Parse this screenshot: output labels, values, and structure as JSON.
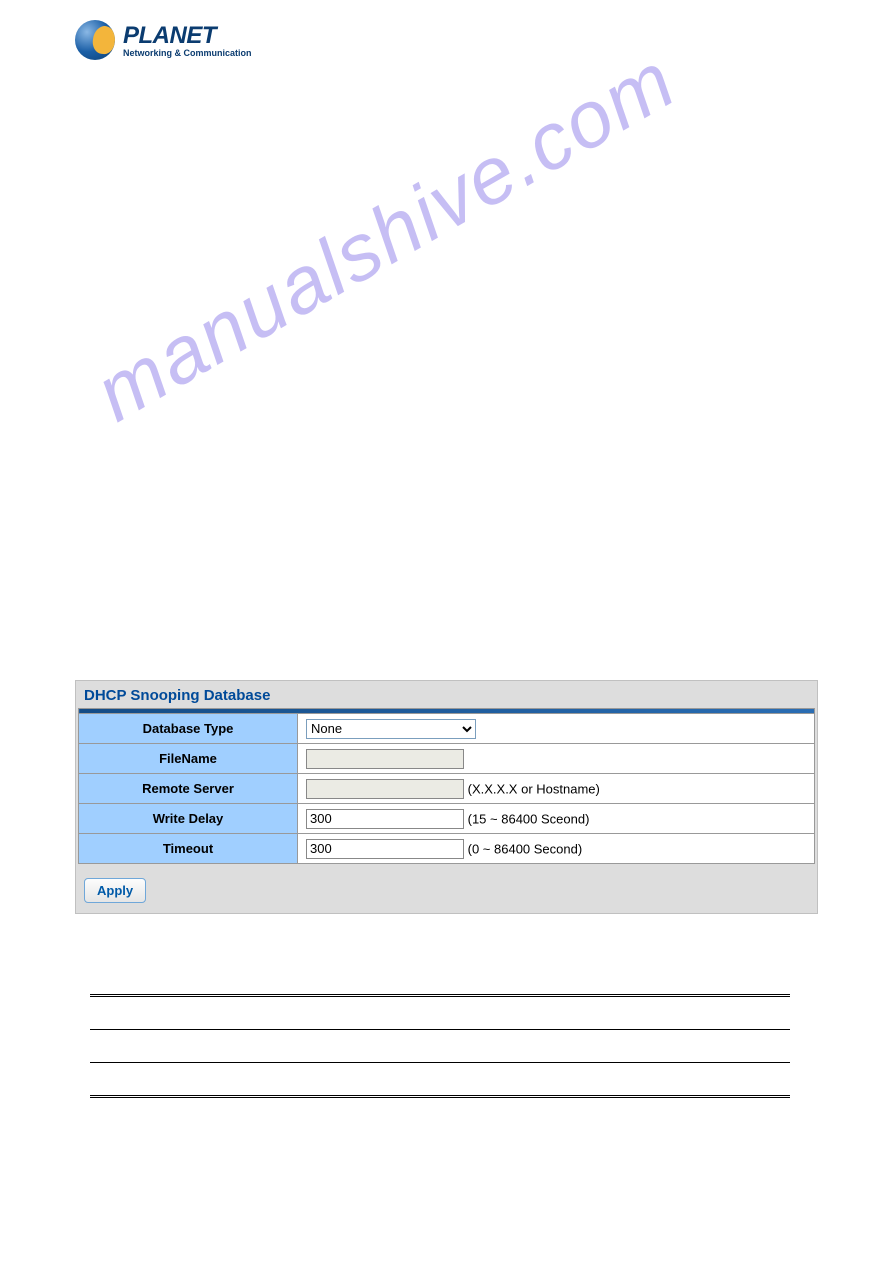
{
  "logo": {
    "brand": "PLANET",
    "tagline": "Networking & Communication"
  },
  "watermark": "manualshive.com",
  "panel": {
    "title": "DHCP Snooping Database",
    "rows": {
      "database_type": {
        "label": "Database Type",
        "selected": "None"
      },
      "filename": {
        "label": "FileName",
        "value": ""
      },
      "remote_server": {
        "label": "Remote Server",
        "value": "",
        "hint": "(X.X.X.X or Hostname)"
      },
      "write_delay": {
        "label": "Write Delay",
        "value": "300",
        "hint": "(15 ~ 86400 Sceond)"
      },
      "timeout": {
        "label": "Timeout",
        "value": "300",
        "hint": "(0 ~ 86400 Second)"
      }
    },
    "apply_label": "Apply"
  }
}
